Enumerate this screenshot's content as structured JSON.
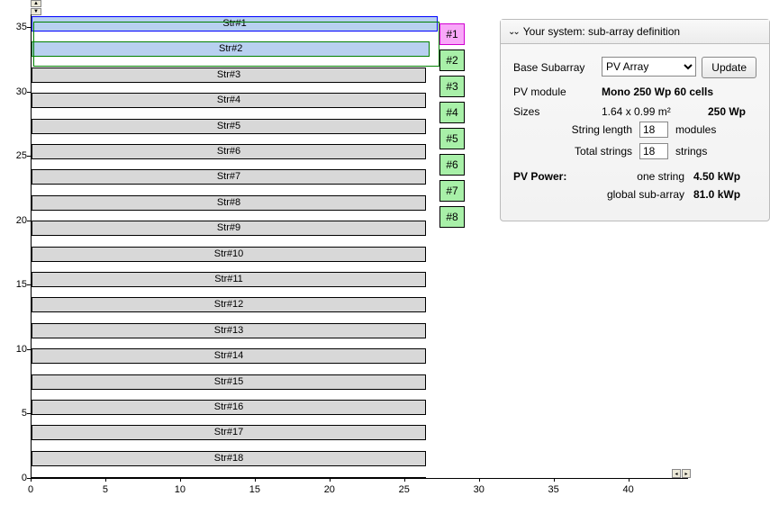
{
  "chart_data": {
    "type": "bar",
    "title": "",
    "xlabel": "",
    "ylabel": "",
    "xlim": [
      0,
      44
    ],
    "ylim": [
      0,
      36
    ],
    "x_ticks": [
      0,
      5,
      10,
      15,
      20,
      25,
      30,
      35,
      40
    ],
    "y_ticks": [
      0,
      5,
      10,
      15,
      20,
      25,
      30,
      35
    ],
    "strings": [
      {
        "label": "Str#1",
        "y_center": 34,
        "width": 30,
        "selected": "blue"
      },
      {
        "label": "Str#2",
        "y_center": 32,
        "width": 30,
        "selected": "green"
      },
      {
        "label": "Str#3",
        "y_center": 30,
        "width": 30,
        "selected": "none"
      },
      {
        "label": "Str#4",
        "y_center": 28,
        "width": 30,
        "selected": "none"
      },
      {
        "label": "Str#5",
        "y_center": 26,
        "width": 30,
        "selected": "none"
      },
      {
        "label": "Str#6",
        "y_center": 24,
        "width": 30,
        "selected": "none"
      },
      {
        "label": "Str#7",
        "y_center": 22,
        "width": 30,
        "selected": "none"
      },
      {
        "label": "Str#8",
        "y_center": 20,
        "width": 30,
        "selected": "none"
      },
      {
        "label": "Str#9",
        "y_center": 18,
        "width": 30,
        "selected": "none"
      },
      {
        "label": "Str#10",
        "y_center": 16,
        "width": 30,
        "selected": "none"
      },
      {
        "label": "Str#11",
        "y_center": 14,
        "width": 30,
        "selected": "none"
      },
      {
        "label": "Str#12",
        "y_center": 12,
        "width": 30,
        "selected": "none"
      },
      {
        "label": "Str#13",
        "y_center": 10,
        "width": 30,
        "selected": "none"
      },
      {
        "label": "Str#14",
        "y_center": 8,
        "width": 30,
        "selected": "none"
      },
      {
        "label": "Str#15",
        "y_center": 6,
        "width": 30,
        "selected": "none"
      },
      {
        "label": "Str#16",
        "y_center": 4,
        "width": 30,
        "selected": "none"
      },
      {
        "label": "Str#17",
        "y_center": 2,
        "width": 30,
        "selected": "none"
      },
      {
        "label": "Str#18",
        "y_center": 0,
        "width": 30,
        "selected": "none"
      }
    ]
  },
  "id_palette": {
    "items": [
      {
        "label": "#1",
        "color": "pink"
      },
      {
        "label": "#2",
        "color": "green"
      },
      {
        "label": "#3",
        "color": "green"
      },
      {
        "label": "#4",
        "color": "green"
      },
      {
        "label": "#5",
        "color": "green"
      },
      {
        "label": "#6",
        "color": "green"
      },
      {
        "label": "#7",
        "color": "green"
      },
      {
        "label": "#8",
        "color": "green"
      }
    ]
  },
  "panel": {
    "title": "Your system: sub-array definition",
    "base_subarray_label": "Base Subarray",
    "base_subarray_value": "PV Array",
    "update_label": "Update",
    "pv_module_label": "PV module",
    "pv_module_value": "Mono 250 Wp  60 cells",
    "sizes_label": "Sizes",
    "sizes_dims": "1.64 x 0.99 m²",
    "sizes_power": "250 Wp",
    "string_length_label": "String length",
    "string_length_value": "18",
    "string_length_unit": "modules",
    "total_strings_label": "Total  strings",
    "total_strings_value": "18",
    "total_strings_unit": "strings",
    "pv_power_label": "PV Power:",
    "one_string_label": "one string",
    "one_string_value": "4.50 kWp",
    "global_label": "global sub-array",
    "global_value": "81.0 kWp"
  }
}
